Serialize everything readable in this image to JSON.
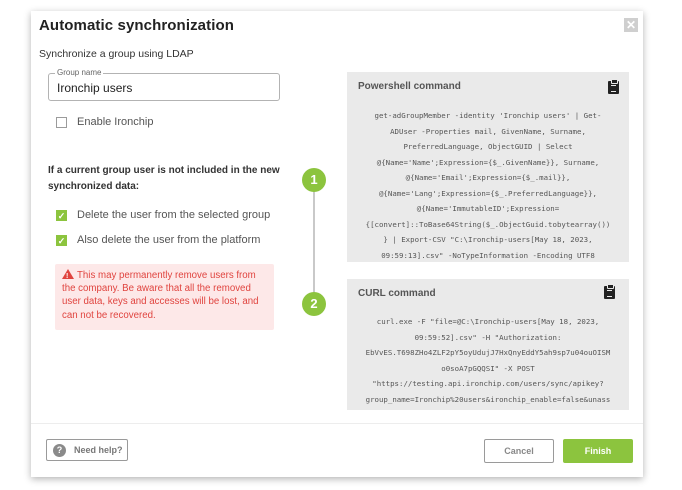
{
  "dialog": {
    "title": "Automatic synchronization",
    "close_glyph": "✕",
    "subtitle": "Synchronize a group using LDAP"
  },
  "group_field": {
    "legend": "Group name",
    "value": "Ironchip users"
  },
  "enable_ironchip": {
    "label": "Enable Ironchip",
    "checked": false
  },
  "question": "If a current group user is not included in the new synchronized data:",
  "options": [
    {
      "label": "Delete the user from the selected group",
      "checked": true,
      "glyph": "✓"
    },
    {
      "label": "Also delete the user from the platform",
      "checked": true,
      "glyph": "✓"
    }
  ],
  "warning": {
    "text": "This may permanently remove users from the company. Be aware that all the removed user data, keys and accesses will be lost, and can not be recovered."
  },
  "steps": [
    "1",
    "2"
  ],
  "powershell": {
    "title": "Powershell command",
    "lines": [
      "get-adGroupMember -identity 'Ironchip users' | Get-",
      "ADUser -Properties mail, GivenName, Surname,",
      "PreferredLanguage, ObjectGUID | Select",
      "@{Name='Name';Expression={$_.GivenName}}, Surname,",
      "@{Name='Email';Expression={$_.mail}},",
      "@{Name='Lang';Expression={$_.PreferredLanguage}},",
      "@{Name='ImmutableID';Expression=",
      "{[convert]::ToBase64String($_.ObjectGuid.tobytearray())",
      "} | Export-CSV \"C:\\Ironchip-users[May 18, 2023,",
      "09:59:13].csv\" -NoTypeInformation -Encoding UTF8"
    ]
  },
  "curl": {
    "title": "CURL command",
    "lines": [
      "curl.exe -F \"file=@C:\\Ironchip-users[May 18, 2023,",
      "09:59:52].csv\" -H \"Authorization:",
      "EbVvES.T698ZHo4ZLF2pY5oyUdujJ7HxQnyEddY5ah9sp7u04ouOISM",
      "o0soA7pGQQSI\" -X POST",
      "\"https://testing.api.ironchip.com/users/sync/apikey?",
      "group_name=Ironchip%20users&ironchip_enable=false&unass"
    ]
  },
  "footer": {
    "help_glyph": "?",
    "help_label": "Need help?",
    "cancel_label": "Cancel",
    "finish_label": "Finish"
  },
  "colors": {
    "accent": "#8cc43e",
    "warning_text": "#e0443f",
    "warning_bg": "#fde8e8",
    "panel_bg": "#eaeaea"
  }
}
